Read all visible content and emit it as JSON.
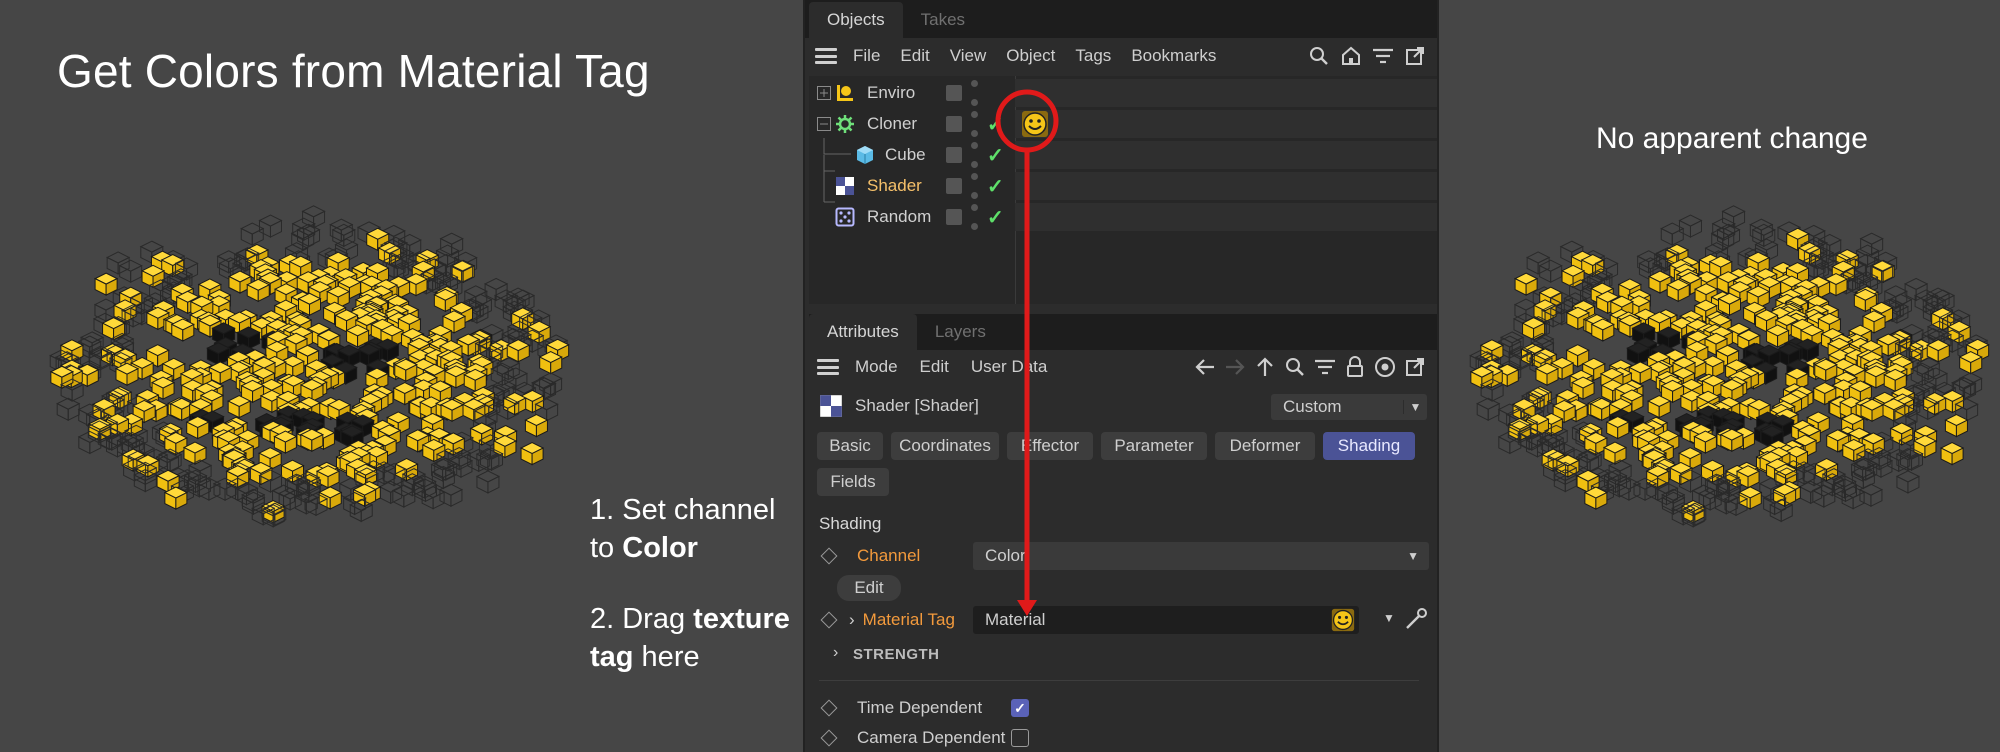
{
  "slide": {
    "title": "Get Colors from Material Tag",
    "side_note": "No apparent change",
    "step1_prefix": "1. Set channel",
    "step1_line2_prefix": "to ",
    "step1_bold": "Color",
    "step2_prefix": "2. Drag ",
    "step2_bold_a": "texture",
    "step2_bold_b": "tag",
    "step2_suffix": " here"
  },
  "colors": {
    "accent": "#4b5396",
    "orange": "#f39a3c",
    "check": "#5ee06a",
    "annotation": "#e01a1a",
    "voxel_yellow": "#f5c518"
  },
  "objects_panel": {
    "tabs": [
      "Objects",
      "Takes"
    ],
    "menu": [
      "File",
      "Edit",
      "View",
      "Object",
      "Tags",
      "Bookmarks"
    ],
    "icons": [
      "search-icon",
      "home-icon",
      "filter-icon",
      "popout-icon"
    ],
    "rows": [
      {
        "name": "Enviro",
        "icon": "light-icon",
        "checked": false
      },
      {
        "name": "Cloner",
        "icon": "cloner-icon",
        "checked": true
      },
      {
        "name": "Cube",
        "icon": "cube-icon",
        "checked": true
      },
      {
        "name": "Shader",
        "icon": "shader-icon",
        "checked": true,
        "highlight": true
      },
      {
        "name": "Random",
        "icon": "random-icon",
        "checked": true
      }
    ]
  },
  "attributes_panel": {
    "tabs": [
      "Attributes",
      "Layers"
    ],
    "menu": [
      "Mode",
      "Edit",
      "User Data"
    ],
    "header": "Shader [Shader]",
    "preset": "Custom",
    "buttons": [
      "Basic",
      "Coordinates",
      "Effector",
      "Parameter",
      "Deformer",
      "Shading",
      "Fields"
    ],
    "active_button": "Shading",
    "section": "Shading",
    "channel_label": "Channel",
    "channel_value": "Color",
    "edit_label": "Edit",
    "material_tag_label": "Material Tag",
    "material_tag_value": "Material",
    "strength_label": "STRENGTH",
    "time_dependent_label": "Time Dependent",
    "time_dependent": true,
    "camera_dependent_label": "Camera Dependent",
    "camera_dependent": false
  }
}
